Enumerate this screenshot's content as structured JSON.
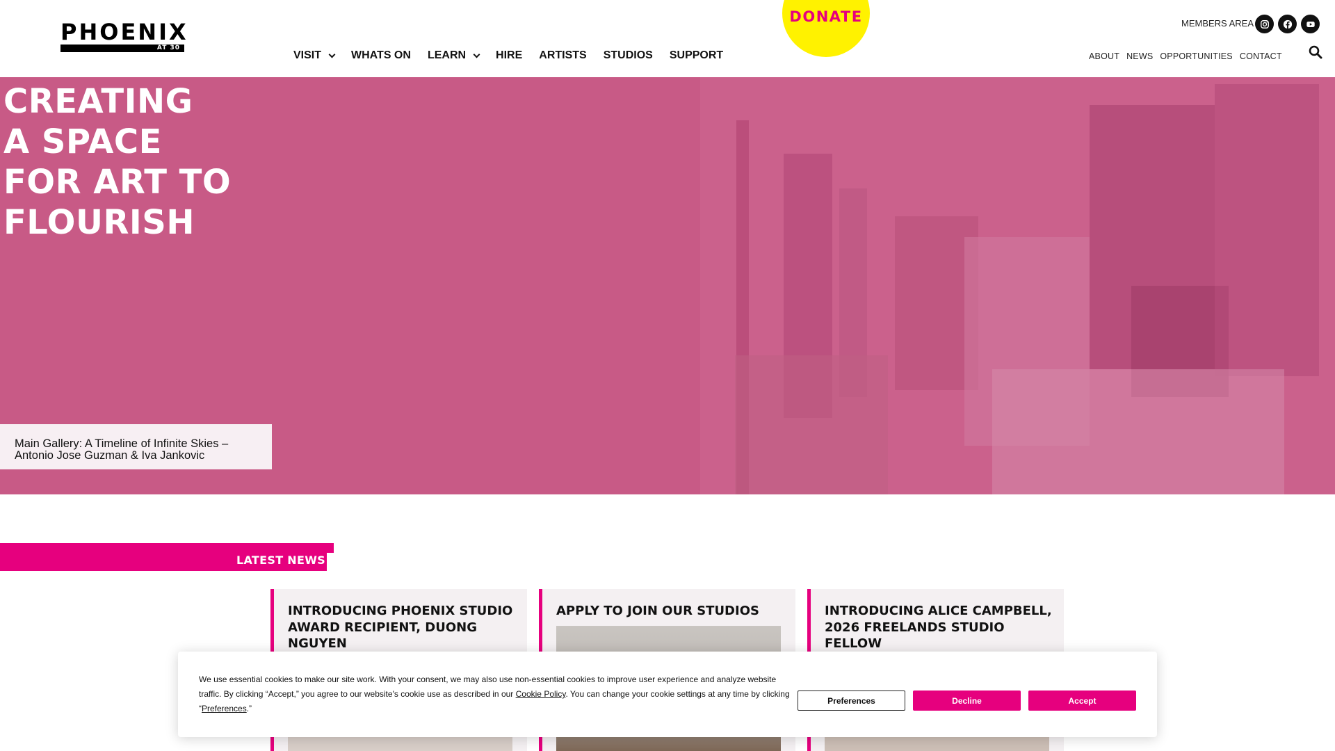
{
  "colors": {
    "brand_pink": "#e6007e",
    "hero_pink": "#c85a86",
    "donate_yellow": "#fff200",
    "text": "#111111"
  },
  "logo": {
    "word": "PHOENIX",
    "sub": "AT 30"
  },
  "main_nav": [
    {
      "label": "VISIT",
      "has_dropdown": true
    },
    {
      "label": "WHATS ON",
      "has_dropdown": false
    },
    {
      "label": "LEARN",
      "has_dropdown": true
    },
    {
      "label": "HIRE",
      "has_dropdown": false
    },
    {
      "label": "ARTISTS",
      "has_dropdown": false
    },
    {
      "label": "STUDIOS",
      "has_dropdown": false
    },
    {
      "label": "SUPPORT",
      "has_dropdown": false
    }
  ],
  "donate": {
    "label": "DONATE"
  },
  "members_area": {
    "label": "MEMBERS AREA"
  },
  "social": [
    {
      "icon": "instagram-icon"
    },
    {
      "icon": "facebook-icon"
    },
    {
      "icon": "youtube-icon"
    }
  ],
  "secondary_nav": [
    "ABOUT",
    "NEWS",
    "OPPORTUNITIES",
    "CONTACT"
  ],
  "search": {
    "icon": "search-icon"
  },
  "hero": {
    "title_lines": [
      "CREATING",
      "A SPACE",
      "FOR ART TO",
      "FLOURISH"
    ],
    "caption_line1": "Main Gallery: A Timeline of Infinite Skies –",
    "caption_line2": "Antonio Jose Guzman & Iva Jankovic"
  },
  "latest_news": {
    "heading": "LATEST NEWS",
    "cards": [
      {
        "title": "INTRODUCING PHOENIX STUDIO AWARD RECIPIENT, DUONG NGUYEN"
      },
      {
        "title": "APPLY TO JOIN OUR STUDIOS"
      },
      {
        "title": "INTRODUCING ALICE CAMPBELL, 2026 FREELANDS STUDIO FELLOW"
      }
    ]
  },
  "cookie_banner": {
    "text_part1": "We use essential cookies to make our site work. With your consent, we may also use non-essential cookies to improve user experience and analyze website traffic. By clicking “Accept,” you agree to our website's cookie use as described in our ",
    "cookie_policy_link": "Cookie Policy",
    "text_part2": ". You can change your cookie settings at any time by clicking “",
    "preferences_link": "Preferences",
    "text_part3": ".”",
    "btn_preferences": "Preferences",
    "btn_decline": "Decline",
    "btn_accept": "Accept"
  }
}
